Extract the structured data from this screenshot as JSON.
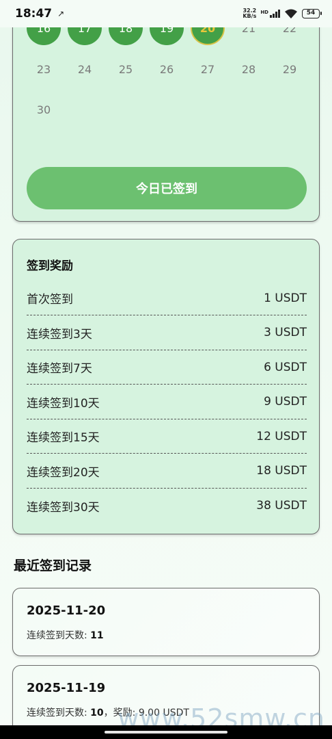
{
  "status_bar": {
    "time": "18:47",
    "net_speed_value": "32.2",
    "net_speed_unit": "KB/s",
    "network_badge": "HD",
    "battery": "54"
  },
  "calendar": {
    "partial_top_row_status": "signed",
    "days": [
      {
        "label": "16",
        "state": "signed"
      },
      {
        "label": "17",
        "state": "signed"
      },
      {
        "label": "18",
        "state": "signed"
      },
      {
        "label": "19",
        "state": "signed"
      },
      {
        "label": "20",
        "state": "today"
      },
      {
        "label": "21",
        "state": "normal"
      },
      {
        "label": "22",
        "state": "normal"
      },
      {
        "label": "23",
        "state": "normal"
      },
      {
        "label": "24",
        "state": "normal"
      },
      {
        "label": "25",
        "state": "normal"
      },
      {
        "label": "26",
        "state": "normal"
      },
      {
        "label": "27",
        "state": "normal"
      },
      {
        "label": "28",
        "state": "normal"
      },
      {
        "label": "29",
        "state": "normal"
      },
      {
        "label": "30",
        "state": "normal"
      }
    ],
    "checkin_button_label": "今日已签到"
  },
  "rewards": {
    "title": "签到奖励",
    "items": [
      {
        "label": "首次签到",
        "value": "1 USDT"
      },
      {
        "label": "连续签到3天",
        "value": "3 USDT"
      },
      {
        "label": "连续签到7天",
        "value": "6 USDT"
      },
      {
        "label": "连续签到10天",
        "value": "9 USDT"
      },
      {
        "label": "连续签到15天",
        "value": "12 USDT"
      },
      {
        "label": "连续签到20天",
        "value": "18 USDT"
      },
      {
        "label": "连续签到30天",
        "value": "38 USDT"
      }
    ]
  },
  "records": {
    "title": "最近签到记录",
    "streak_label": "连续签到天数: ",
    "reward_label": "，奖励: ",
    "items": [
      {
        "date": "2025-11-20",
        "streak": "11",
        "reward": ""
      },
      {
        "date": "2025-11-19",
        "streak": "10",
        "reward": "9.00 USDT"
      }
    ]
  },
  "watermark": "www.52smw.cn",
  "colors": {
    "accent_green": "#43a047",
    "button_green": "#6cc070",
    "card_bg": "#d6f3df",
    "today_ring": "#d8c246"
  }
}
